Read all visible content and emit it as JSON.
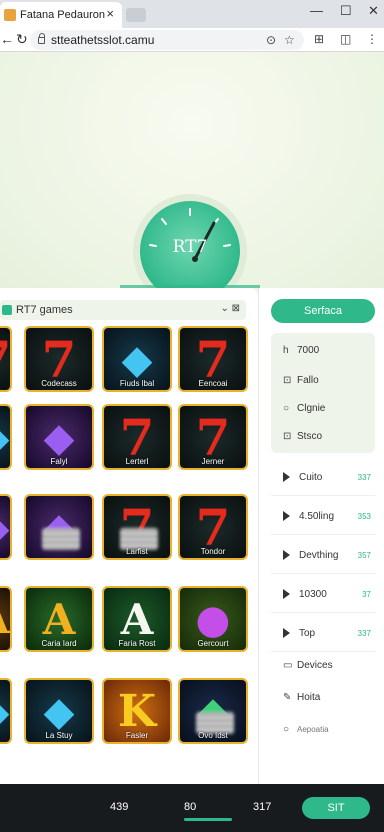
{
  "browser": {
    "tab_title": "Fatana Pedauron",
    "tab_close": "×",
    "url": "stteathetsslot.camu",
    "win_minimize": "—",
    "win_maximize": "☐",
    "win_close": "✕"
  },
  "hero": {
    "gauge_label": "RT7"
  },
  "games_panel": {
    "header_title": "RT7 games",
    "header_controls": "⌄ ⊠"
  },
  "games": [
    {
      "label": "",
      "art": "7",
      "theme": "red7"
    },
    {
      "label": "Codecass",
      "art": "7",
      "theme": "red7"
    },
    {
      "label": "Fiuds lbal",
      "art": "◆",
      "theme": "diamond-blue"
    },
    {
      "label": "Eencoai",
      "art": "7",
      "theme": "red7"
    },
    {
      "label": "",
      "art": "◆",
      "theme": "diamond-blue"
    },
    {
      "label": "Falyl",
      "art": "◆",
      "theme": "diamond-purple"
    },
    {
      "label": "Lerterl",
      "art": "7",
      "theme": "red7"
    },
    {
      "label": "Jerner",
      "art": "7",
      "theme": "red7"
    },
    {
      "label": "",
      "art": "◆",
      "theme": "diamond-purple"
    },
    {
      "label": "",
      "art": "◆",
      "theme": "diamond-purple",
      "blurred": true
    },
    {
      "label": "Larfist",
      "art": "7",
      "theme": "red7",
      "blurred": true
    },
    {
      "label": "Tondor",
      "art": "7",
      "theme": "red7"
    },
    {
      "label": "",
      "art": "A",
      "theme": "gold"
    },
    {
      "label": "Caria Iard",
      "art": "A",
      "theme": "a-gold"
    },
    {
      "label": "Faria Rost",
      "art": "A",
      "theme": "a-green"
    },
    {
      "label": "Gercourt",
      "art": "●",
      "theme": "gem-purple"
    },
    {
      "label": "",
      "art": "◆",
      "theme": "diamond-blue"
    },
    {
      "label": "La Stuy",
      "art": "◆",
      "theme": "diamond-blue"
    },
    {
      "label": "Fasler",
      "art": "K",
      "theme": "k-gold"
    },
    {
      "label": "Ovo Idst",
      "art": "◆",
      "theme": "gem-green",
      "blurred": true
    }
  ],
  "sidebar": {
    "search_label": "Serfaca",
    "filters": [
      {
        "icon": "h",
        "label": "7000"
      },
      {
        "icon": "⊡",
        "label": "Fallo"
      },
      {
        "icon": "○",
        "label": "Clgnie"
      },
      {
        "icon": "⊡",
        "label": "Stsco"
      }
    ],
    "categories": [
      {
        "label": "Cuito",
        "count": "337"
      },
      {
        "label": "4.50ling",
        "count": "353"
      },
      {
        "label": "Devthing",
        "count": "357"
      },
      {
        "label": "10300",
        "count": "37"
      },
      {
        "label": "Top",
        "count": "337"
      }
    ],
    "links": [
      {
        "icon": "▭",
        "label": "Devices"
      },
      {
        "icon": "✎",
        "label": "Hoita"
      },
      {
        "icon": "○",
        "label": "Aepoatia"
      }
    ]
  },
  "bottom": {
    "stat1": "439",
    "stat2": "80",
    "stat3": "317",
    "spin_label": "SIT"
  }
}
